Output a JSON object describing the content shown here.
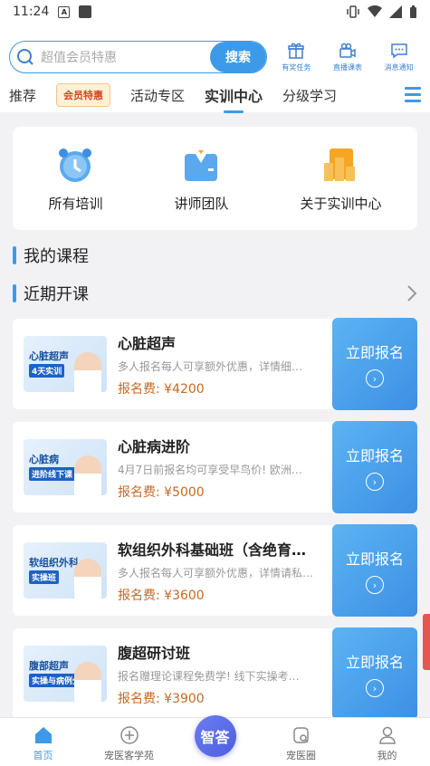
{
  "status_bar": {
    "time": "11:24",
    "notif_letter": "A"
  },
  "search": {
    "placeholder": "超值会员特惠",
    "button": "搜索"
  },
  "tools": [
    {
      "icon": "gift-icon",
      "label": "有奖任务"
    },
    {
      "icon": "video-camera-icon",
      "label": "直播课表"
    },
    {
      "icon": "message-icon",
      "label": "消息通知"
    }
  ],
  "tabs": {
    "items": [
      "推荐",
      "活动专区",
      "实训中心",
      "分级学习"
    ],
    "badge": "会员特惠",
    "active": "实训中心"
  },
  "quick": [
    {
      "label": "所有培训",
      "icon": "clock-icon"
    },
    {
      "label": "讲师团队",
      "icon": "suit-icon"
    },
    {
      "label": "关于实训中心",
      "icon": "chart-icon"
    }
  ],
  "sections": {
    "my_courses": "我的课程",
    "upcoming": "近期开课"
  },
  "courses": [
    {
      "name": "心脏超声",
      "desc": "多人报名每人可享额外优惠，详情细…",
      "price": "报名费: ¥4200",
      "thumb_title": "心脏超声",
      "thumb_sub": "4天实训"
    },
    {
      "name": "心脏病进阶",
      "desc": "4月7日前报名均可享受早鸟价! 欧洲…",
      "price": "报名费: ¥5000",
      "thumb_title": "心脏病",
      "thumb_sub": "进阶线下课"
    },
    {
      "name": "软组织外科基础班（含绝育、…",
      "desc": "多人报名每人可享额外优惠，详情请私聊…",
      "price": "报名费: ¥3600",
      "thumb_title": "软组织外科",
      "thumb_sub": "实操班"
    },
    {
      "name": "腹超研讨班",
      "desc": "报名赠理论课程免费学! 线下实操考…",
      "price": "报名费: ¥3900",
      "thumb_title": "腹部超声",
      "thumb_sub": "实操与病例分析"
    }
  ],
  "enroll_label": "立即报名",
  "bottom_nav": {
    "home": "首页",
    "academy": "宠医客学苑",
    "center": "智答",
    "circle": "宠医圈",
    "mine": "我的"
  },
  "colors": {
    "accent": "#3d9ae8",
    "price": "#c46a24"
  }
}
